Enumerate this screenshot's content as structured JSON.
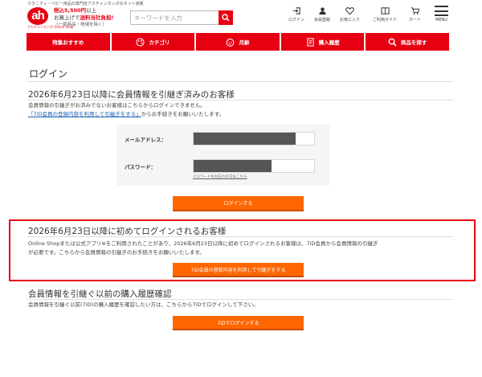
{
  "header": {
    "tagline": "マタニティ・ベビー用品の専門店アカチャンホンポのネット通販",
    "logo_text": "ah",
    "logo_sub": "アカチャンホンポ Online Shop",
    "promo_line1_a": "税込5,500円",
    "promo_line1_b": "以上",
    "promo_line2_a": "お買上げで",
    "promo_line2_b": "送料当社負担!",
    "promo_line3": "（一部商品・地域を除く）",
    "search_placeholder": "キーワードを入力",
    "nav": [
      {
        "label": "ログイン",
        "icon": "login-icon"
      },
      {
        "label": "会員登録",
        "icon": "member-icon"
      },
      {
        "label": "お気に入り",
        "icon": "heart-icon"
      },
      {
        "label": "ご利用ガイド",
        "icon": "guide-icon"
      },
      {
        "label": "カート",
        "icon": "cart-icon"
      }
    ],
    "menu_label": "MENU"
  },
  "navbar": [
    {
      "label": "特集おすすめ",
      "icon": ""
    },
    {
      "label": "カテゴリ",
      "icon": "palette-icon"
    },
    {
      "label": "月齢",
      "icon": "baby-face-icon"
    },
    {
      "label": "購入履歴",
      "icon": "receipt-icon"
    },
    {
      "label": "商品を探す",
      "icon": "search-icon"
    }
  ],
  "main": {
    "title": "ログイン",
    "section1": {
      "heading": "2026年6月23日以降に会員情報を引継ぎ済みのお客様",
      "text1": "会員情報の引継ぎがお済みでないお客様はこちらからログインできません。",
      "link": "「7iD会員の登録内容を利用して引継ぎをする」",
      "text2": "からお手続きをお願いいたします。",
      "email_label": "メールアドレス：",
      "password_label": "パスワード：",
      "forgot": "パスワードをお忘れの方はこちら",
      "login_button": "ログインする"
    },
    "section2": {
      "heading": "2026年6月23日以降に初めてログインされるお客様",
      "text1": "Online Shopまたは公式アプリ※をご利用されたことがあり、2026年6月23日以降に初めてログインされるお客様は、7iD会員から会員情報の引継ぎ",
      "text2": "が必要です。こちらから会員情報の引継ぎのお手続きをお願いいたします。",
      "button": "7iD会員の登録内容を利用して引継ぎをする"
    },
    "section3": {
      "heading": "会員情報を引継ぐ以前の購入履歴確認",
      "text": "会員情報を引継ぐ以前(7iD)の購入履歴を確認したい方は、こちらから7iDでログインして下さい。",
      "button": "7iDでログインする"
    }
  },
  "colors": {
    "brand_red": "#e60012",
    "button_orange": "#ff6600",
    "link_blue": "#1a5fb4"
  }
}
